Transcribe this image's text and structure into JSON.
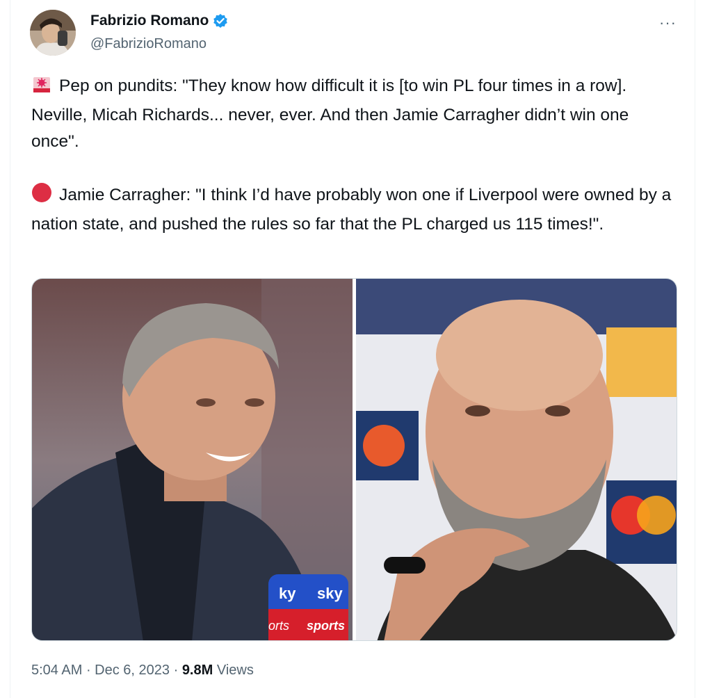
{
  "author": {
    "name": "Fabrizio Romano",
    "handle": "@FabrizioRomano"
  },
  "menu": {
    "more_label": "···"
  },
  "tweet": {
    "paragraph1": "Pep on pundits: \"They know how difficult it is [to win PL four times in a row]. Neville, Micah Richards... never, ever. And then Jamie Carragher didn’t win one once\".",
    "paragraph2": "Jamie Carragher: \"I think I’d have probably won one if Liverpool were owned by a nation state, and pushed the rules so far that the PL charged us 115 times!\"."
  },
  "media": {
    "left_mic": {
      "brand_top": "sky",
      "brand_bottom": "sports"
    },
    "left_mic_partial": {
      "top": "ky",
      "bottom": "orts"
    }
  },
  "meta": {
    "time": "5:04 AM",
    "sep1": " · ",
    "date": "Dec 6, 2023",
    "sep2": " · ",
    "views_count": "9.8M",
    "views_label": " Views"
  },
  "colors": {
    "verified": "#1d9bf0",
    "text": "#0f1419",
    "secondary": "#536471",
    "red_dot": "#e0245e"
  },
  "icons": {
    "emoji1": "siren-icon",
    "emoji2": "red-circle-icon",
    "verified": "verified-badge-icon"
  }
}
